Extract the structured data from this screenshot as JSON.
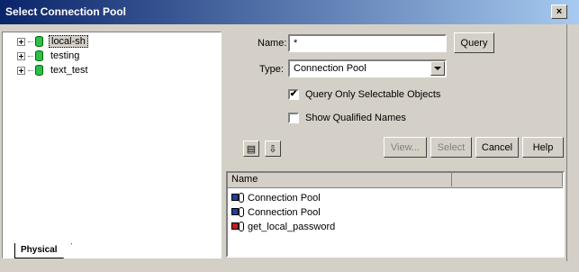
{
  "window": {
    "title": "Select Connection Pool",
    "close_label": "×"
  },
  "tree": {
    "items": [
      {
        "label": "local-sh",
        "selected": true
      },
      {
        "label": "testing",
        "selected": false
      },
      {
        "label": "text_test",
        "selected": false
      }
    ],
    "tab_label": "Physical"
  },
  "form": {
    "name_label": "Name:",
    "name_value": "*",
    "query_label": "Query",
    "type_label": "Type:",
    "type_value": "Connection Pool",
    "query_selectable_label": "Query Only Selectable Objects",
    "query_selectable_checked": true,
    "show_qualified_label": "Show Qualified Names",
    "show_qualified_checked": false
  },
  "buttons": {
    "view": "View...",
    "select": "Select",
    "cancel": "Cancel",
    "help": "Help"
  },
  "results": {
    "column_name": "Name",
    "rows": [
      {
        "label": "Connection Pool",
        "icon": "connection-pool-icon"
      },
      {
        "label": "Connection Pool",
        "icon": "connection-pool-icon"
      },
      {
        "label": "get_local_password",
        "icon": "init-block-icon"
      }
    ]
  }
}
